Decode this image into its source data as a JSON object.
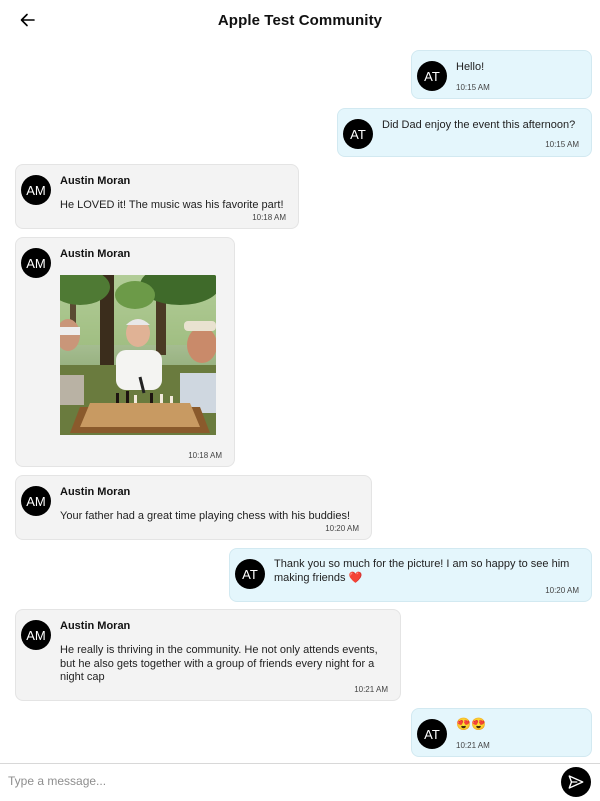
{
  "header": {
    "title": "Apple Test Community",
    "back_icon": "arrow-left-icon"
  },
  "messages": [
    {
      "side": "out",
      "initials": "AT",
      "text": "Hello!",
      "time": "10:15 AM"
    },
    {
      "side": "out",
      "initials": "AT",
      "text": "Did Dad enjoy the event this afternoon?",
      "time": "10:15 AM"
    },
    {
      "side": "in",
      "initials": "AM",
      "sender": "Austin Moran",
      "text": "He LOVED it! The music was his favorite part!",
      "time": "10:18 AM"
    },
    {
      "side": "in",
      "initials": "AM",
      "sender": "Austin Moran",
      "image": "photo of elderly men playing chess in a park",
      "time": "10:18 AM"
    },
    {
      "side": "in",
      "initials": "AM",
      "sender": "Austin Moran",
      "text": "Your father had a great time playing chess with his buddies!",
      "time": "10:20 AM"
    },
    {
      "side": "out",
      "initials": "AT",
      "text": "Thank you so much for the picture! I am so happy to see him making friends ❤️",
      "time": "10:20 AM"
    },
    {
      "side": "in",
      "initials": "AM",
      "sender": "Austin Moran",
      "text": "He really is thriving in the community. He not only attends events, but he also gets together with a group of friends every night for a night cap",
      "time": "10:21 AM"
    },
    {
      "side": "out",
      "initials": "AT",
      "text": "😍😍",
      "time": "10:21 AM"
    }
  ],
  "composer": {
    "placeholder": "Type a message...",
    "send_icon": "send-icon"
  },
  "colors": {
    "outgoing_bubble": "#e4f6fc",
    "incoming_bubble": "#f3f3f3",
    "avatar": "#000000"
  }
}
